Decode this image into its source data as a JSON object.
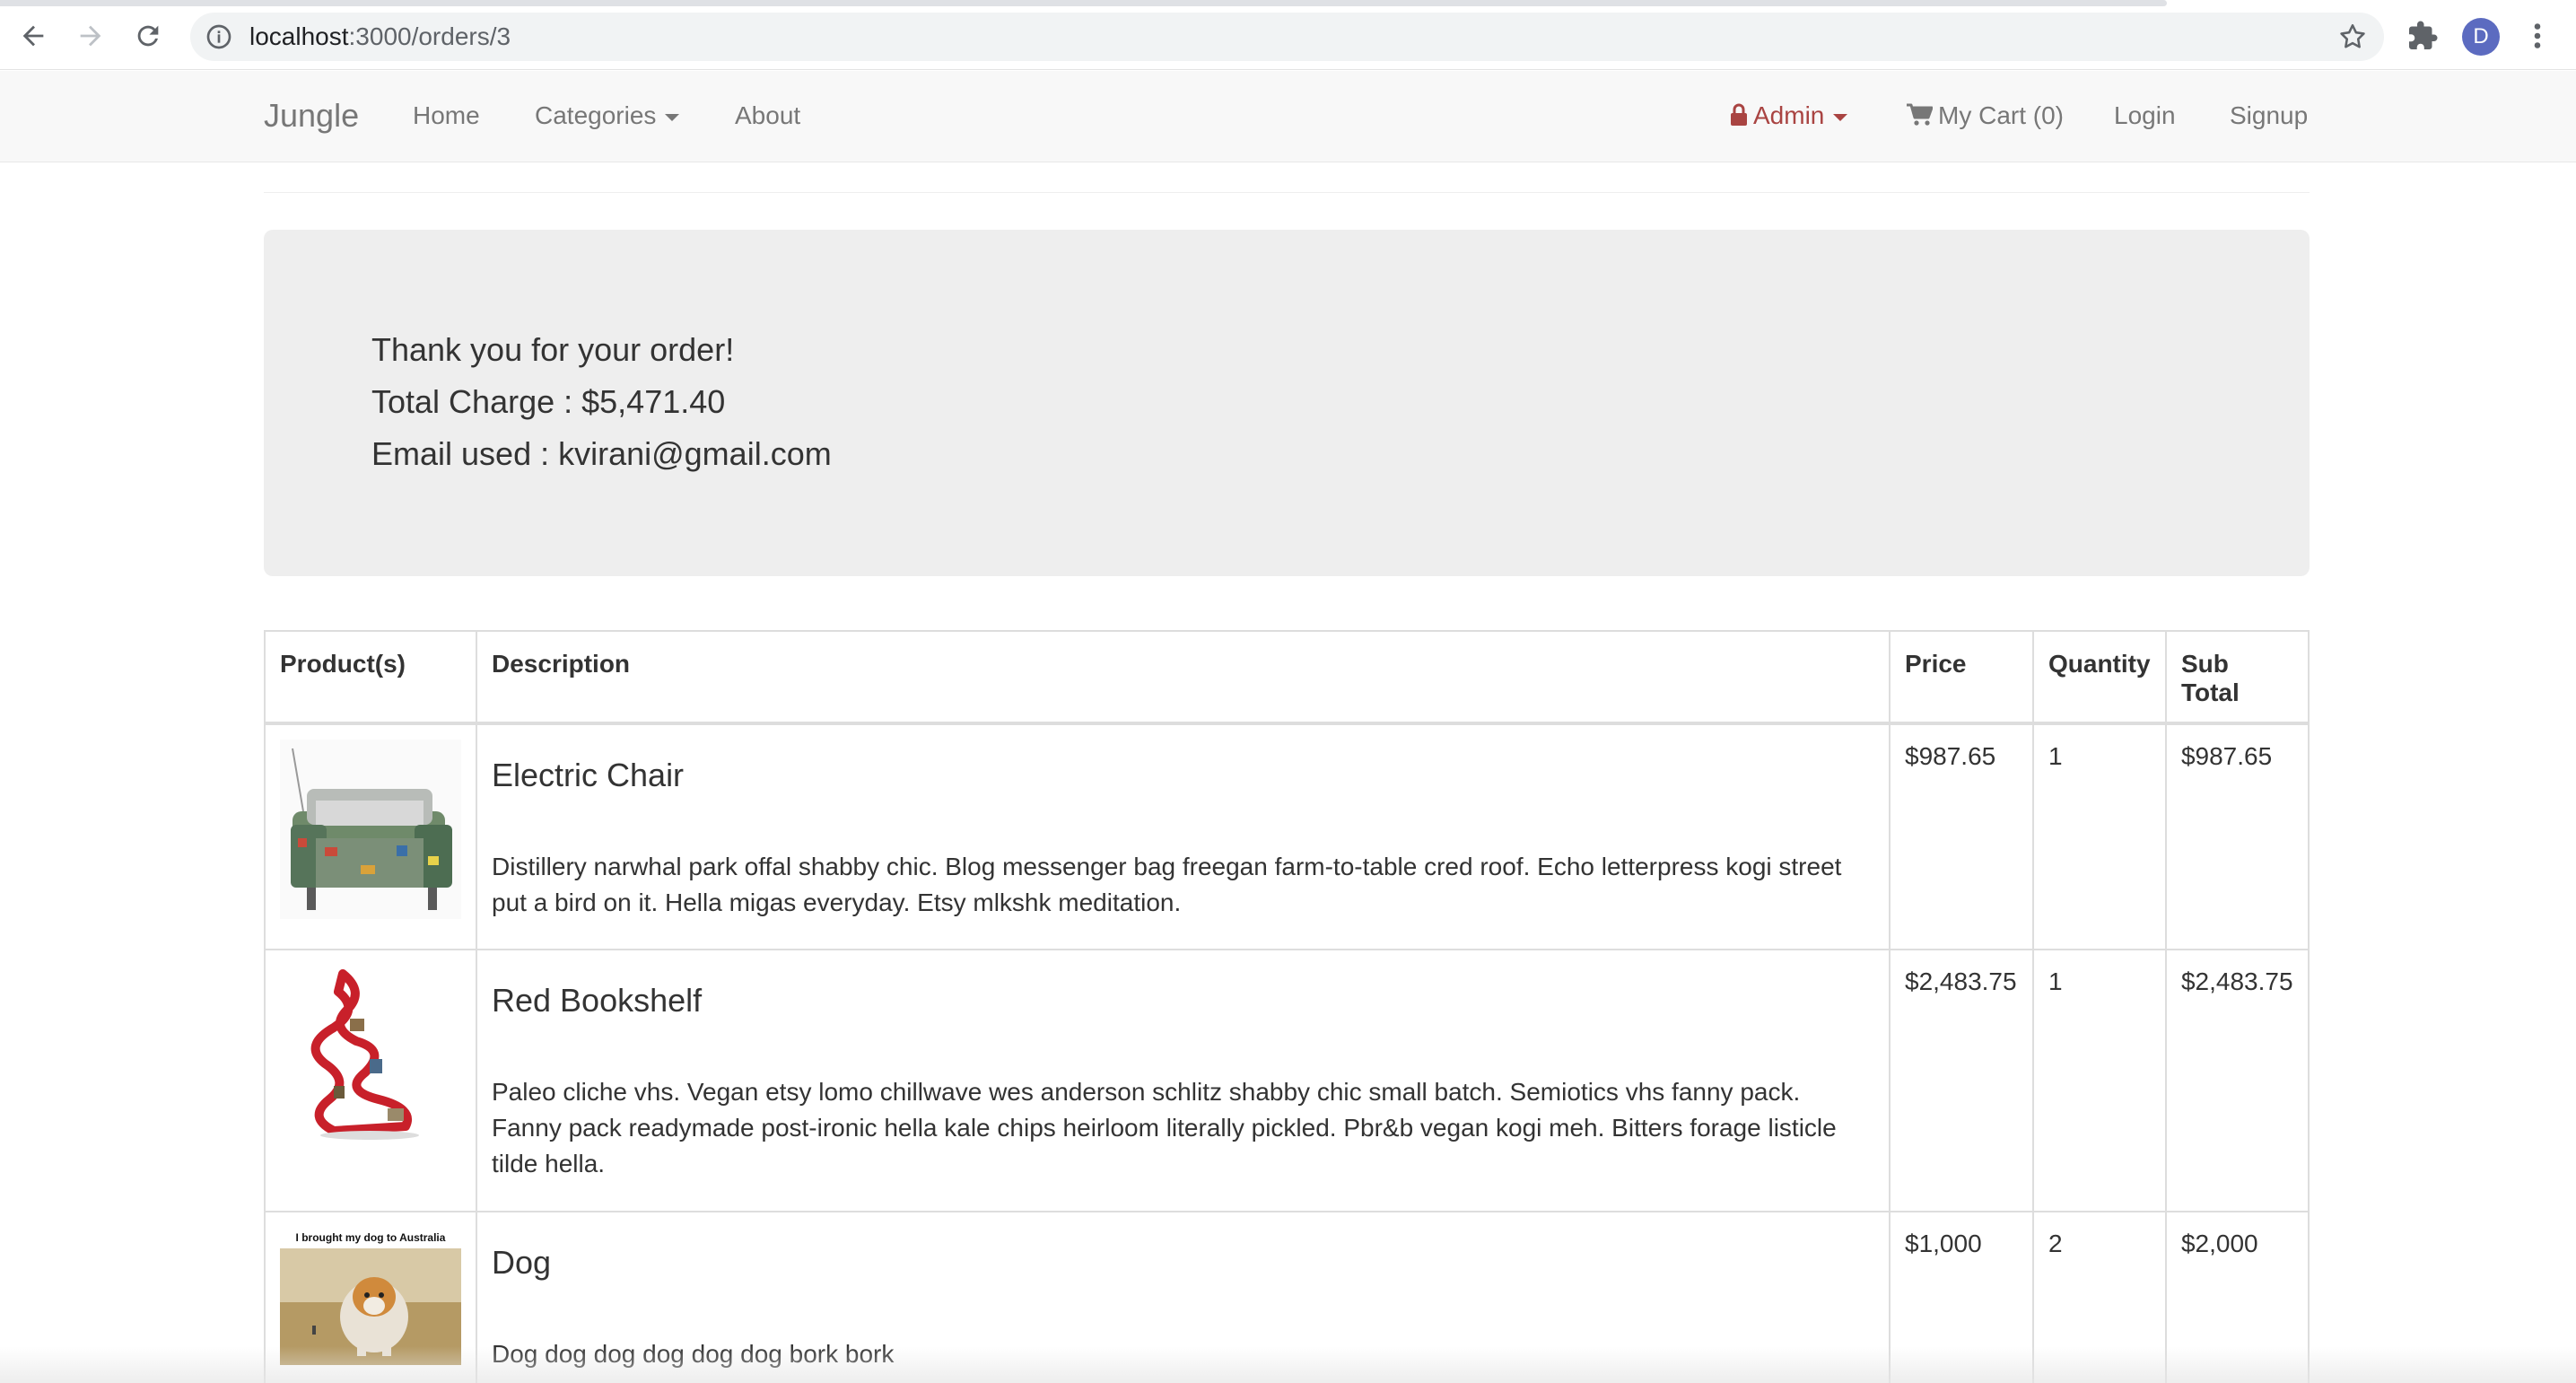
{
  "browser": {
    "url_host": "localhost",
    "url_path": ":3000/orders/3",
    "profile_initial": "D"
  },
  "navbar": {
    "brand": "Jungle",
    "home": "Home",
    "categories": "Categories",
    "about": "About",
    "admin": "Admin",
    "cart": "My Cart (0)",
    "login": "Login",
    "signup": "Signup",
    "admin_color": "#a94442"
  },
  "order": {
    "thank_you": "Thank you for your order!",
    "total_charge": "Total Charge : $5,471.40",
    "email_used": "Email used : kvirani@gmail.com"
  },
  "table": {
    "headers": {
      "products": "Product(s)",
      "description": "Description",
      "price": "Price",
      "quantity": "Quantity",
      "subtotal": "Sub Total"
    },
    "rows": [
      {
        "name": "Electric Chair",
        "description": "Distillery narwhal park offal shabby chic. Blog messenger bag freegan farm-to-table cred roof. Echo letterpress kogi street put a bird on it. Hella migas everyday. Etsy mlkshk meditation.",
        "price": "$987.65",
        "quantity": "1",
        "subtotal": "$987.65",
        "image": "armchair-photo"
      },
      {
        "name": "Red Bookshelf",
        "description": "Paleo cliche vhs. Vegan etsy lomo chillwave wes anderson schlitz shabby chic small batch. Semiotics vhs fanny pack. Fanny pack readymade post-ironic hella kale chips heirloom literally pickled. Pbr&b vegan kogi meh. Bitters forage listicle tilde hella.",
        "price": "$2,483.75",
        "quantity": "1",
        "subtotal": "$2,483.75",
        "image": "red-bookshelf-photo"
      },
      {
        "name": "Dog",
        "description": "Dog dog dog dog dog dog bork bork",
        "price": "$1,000",
        "quantity": "2",
        "subtotal": "$2,000",
        "image": "dog-photo",
        "image_caption": "I brought my dog to Australia"
      }
    ]
  }
}
